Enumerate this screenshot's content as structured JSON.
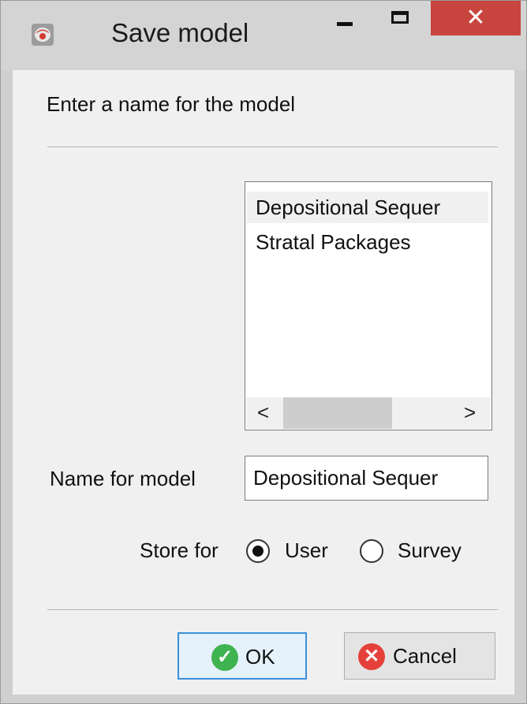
{
  "window": {
    "title": "Save model",
    "app_icon": "app-logo-icon",
    "controls": {
      "minimize_icon": "minimize-icon",
      "maximize_icon": "maximize-icon",
      "close_glyph": "✕"
    }
  },
  "dialog": {
    "prompt": "Enter a name for the model",
    "existing_models": [
      {
        "label": "Depositional Sequer",
        "selected": true
      },
      {
        "label": "Stratal Packages",
        "selected": false
      }
    ],
    "scrollbar": {
      "left_arrow": "<",
      "right_arrow": ">"
    },
    "name_label": "Name for model",
    "name_value": "Depositional Sequer",
    "store_label": "Store for",
    "store_options": [
      {
        "label": "User",
        "checked": true
      },
      {
        "label": "Survey",
        "checked": false
      }
    ],
    "buttons": {
      "ok": {
        "label": "OK",
        "icon": "check-icon",
        "color": "#3fb34f"
      },
      "cancel": {
        "label": "Cancel",
        "icon": "cancel-x-icon",
        "color": "#e5413a"
      }
    }
  }
}
